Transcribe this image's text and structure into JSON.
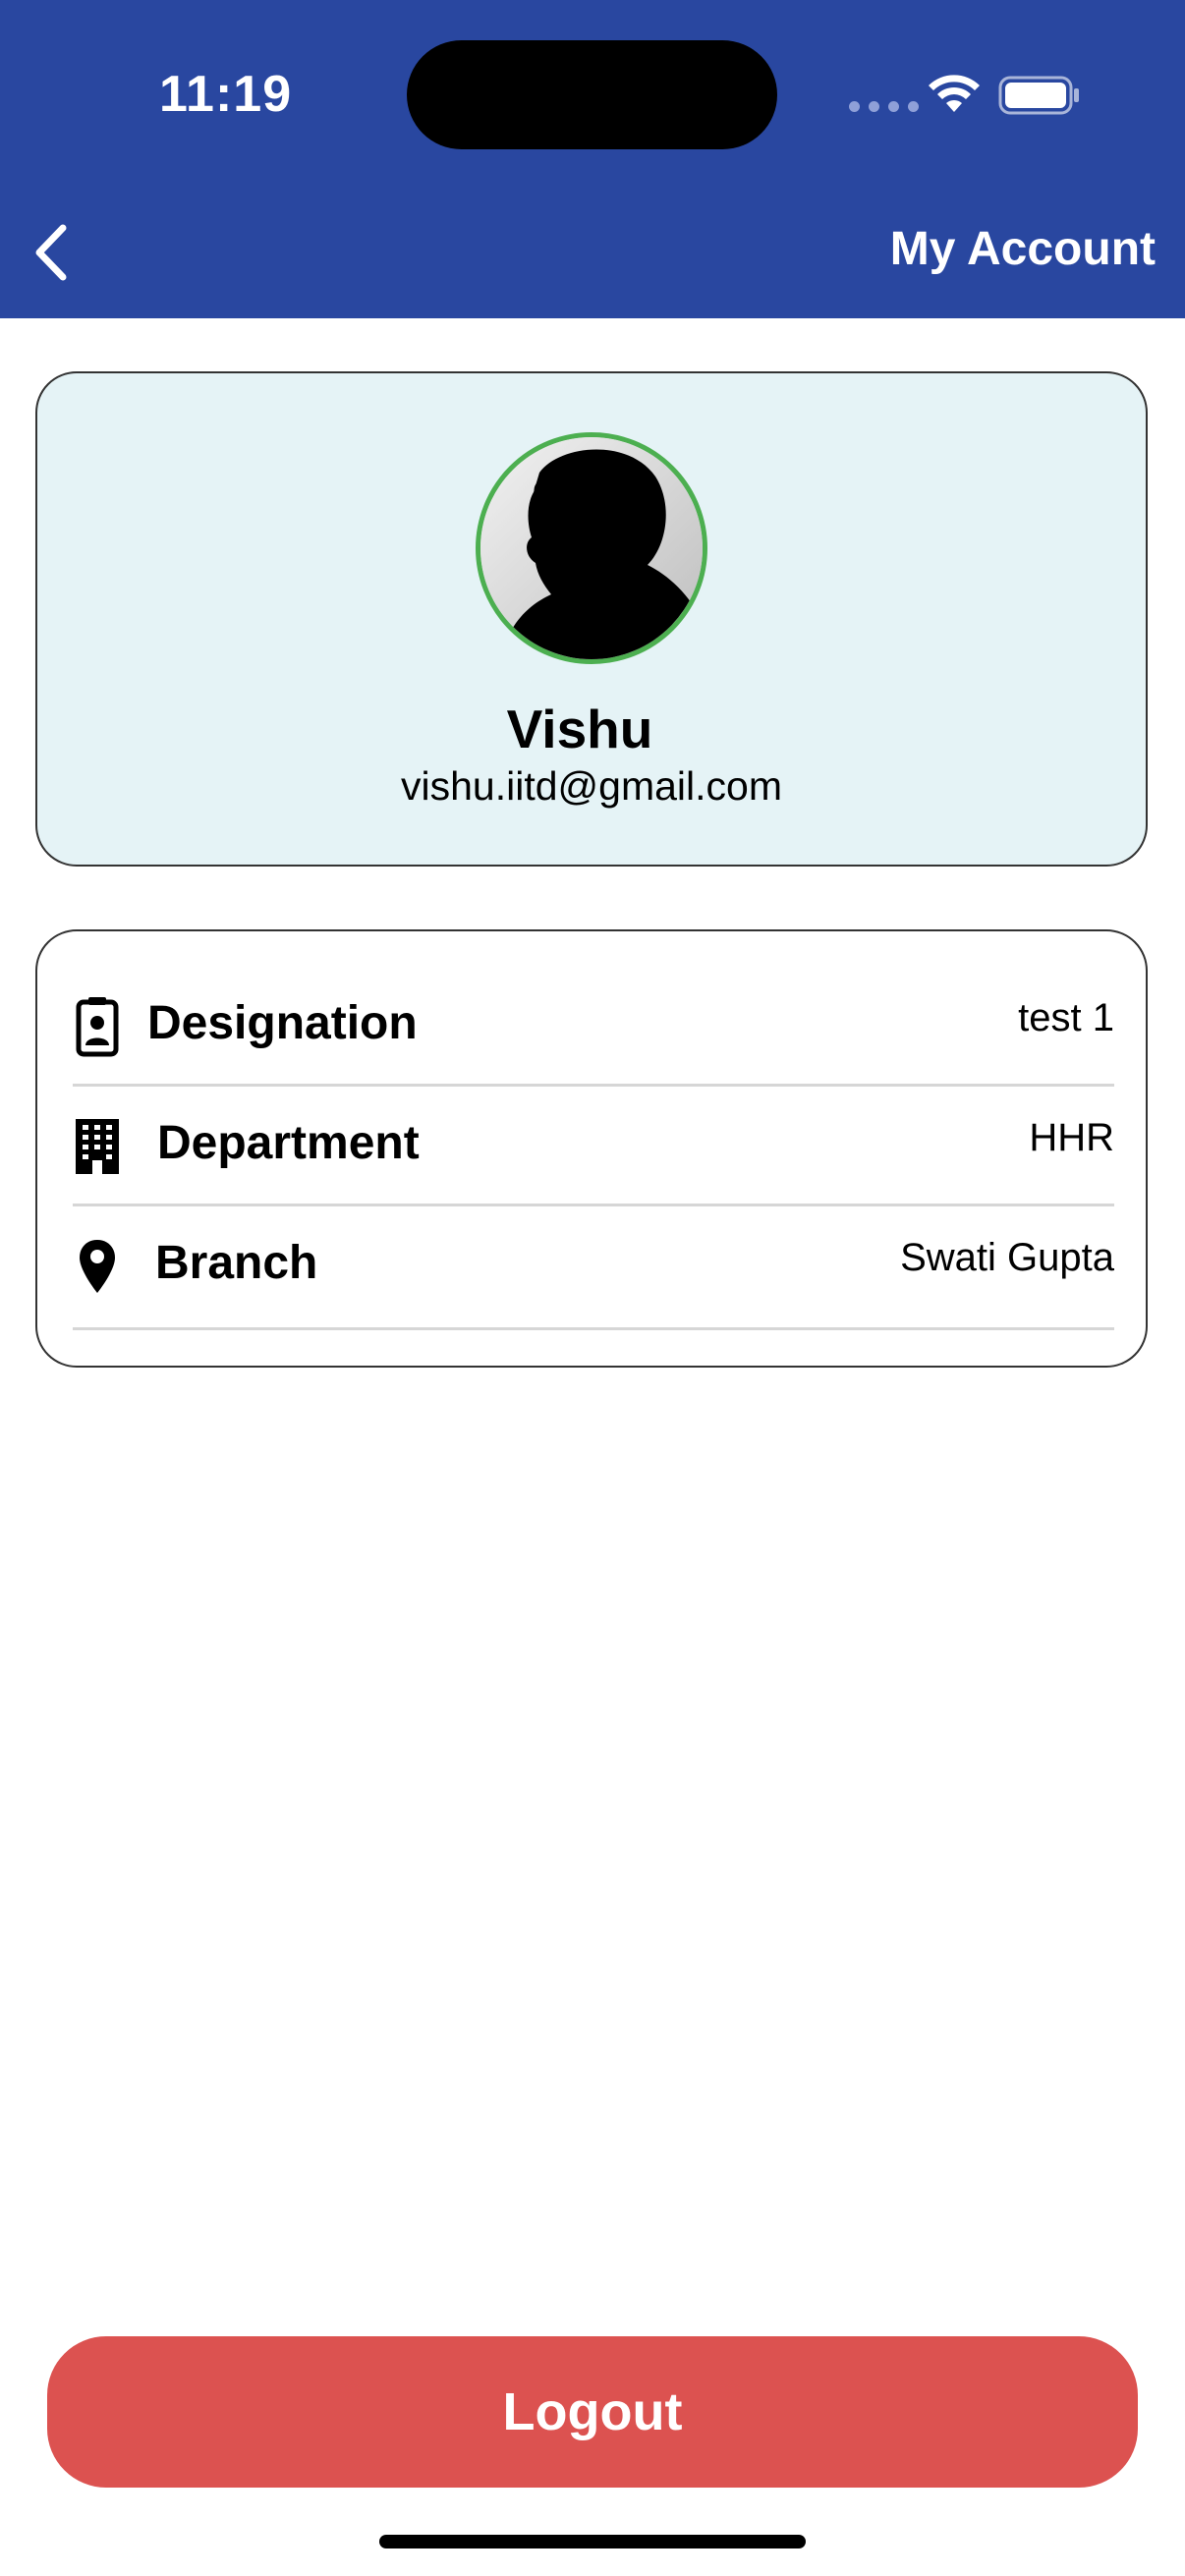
{
  "status_bar": {
    "time": "11:19",
    "icons": [
      "signal-dots-icon",
      "wifi-icon",
      "battery-icon"
    ]
  },
  "header": {
    "back_icon": "chevron-left-icon",
    "title": "My Account",
    "background_color": "#2947a0"
  },
  "profile": {
    "name": "Vishu",
    "email": "vishu.iitd@gmail.com",
    "avatar_border_color": "#4caf50",
    "card_background": "#e5f3f6"
  },
  "details": [
    {
      "icon": "id-badge-icon",
      "label": "Designation",
      "value": "test 1"
    },
    {
      "icon": "building-icon",
      "label": "Department",
      "value": "HHR"
    },
    {
      "icon": "map-pin-icon",
      "label": "Branch",
      "value": "Swati Gupta"
    }
  ],
  "logout": {
    "label": "Logout",
    "color": "#dc5250"
  }
}
